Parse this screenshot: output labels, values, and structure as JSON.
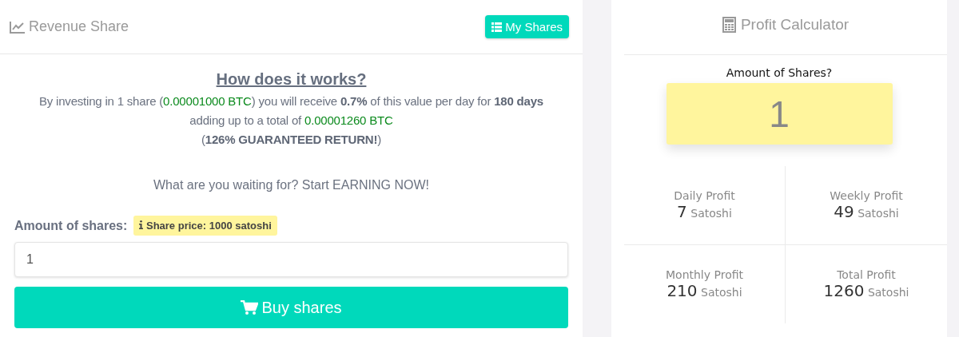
{
  "revenue_panel": {
    "title": "Revenue Share",
    "my_shares_button": "My Shares",
    "heading": "How does it works?",
    "description_lines": [
      [
        {
          "kind": "text",
          "text": "By investing in 1 share ("
        },
        {
          "kind": "amount",
          "text": "0.00001000 BTC"
        },
        {
          "kind": "text",
          "text": ") you will receive "
        },
        {
          "kind": "bold",
          "text": "0.7%"
        },
        {
          "kind": "text",
          "text": " of this value per day for "
        },
        {
          "kind": "bold",
          "text": "180 days"
        }
      ],
      [
        {
          "kind": "text",
          "text": "adding up to a total of "
        },
        {
          "kind": "amount",
          "text": "0.00001260 BTC"
        }
      ],
      [
        {
          "kind": "text",
          "text": "("
        },
        {
          "kind": "bold",
          "text": "126% GUARANTEED RETURN!"
        },
        {
          "kind": "text",
          "text": ")"
        }
      ]
    ],
    "call_to_action": "What are you waiting for? Start EARNING NOW!",
    "amount_label": "Amount of shares:",
    "price_badge": "Share price: 1000 satoshi",
    "amount_value": "1",
    "buy_button": "Buy shares"
  },
  "profit_calculator": {
    "title": "Profit Calculator",
    "amount_label": "Amount of Shares?",
    "amount_value": "1",
    "stats": [
      {
        "label": "Daily Profit",
        "value": "7",
        "unit": "Satoshi"
      },
      {
        "label": "Weekly Profit",
        "value": "49",
        "unit": "Satoshi"
      },
      {
        "label": "Monthly Profit",
        "value": "210",
        "unit": "Satoshi"
      },
      {
        "label": "Total Profit",
        "value": "1260",
        "unit": "Satoshi"
      }
    ]
  }
}
